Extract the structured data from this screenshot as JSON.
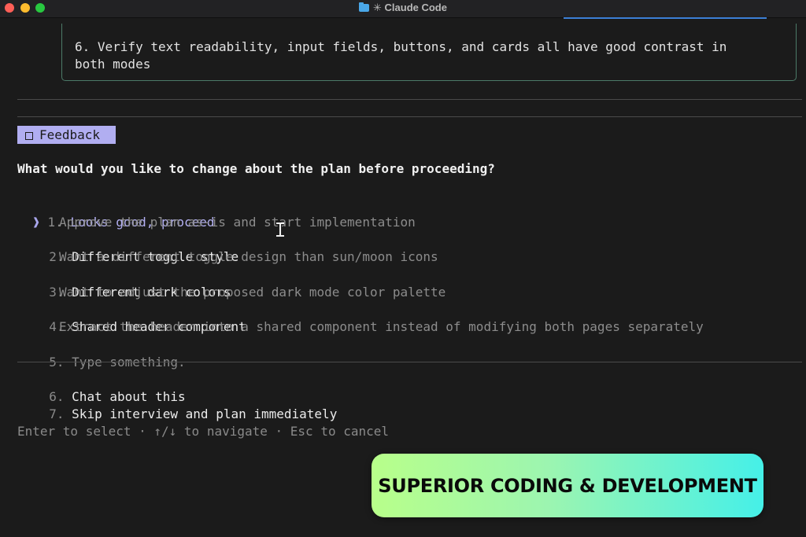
{
  "window": {
    "title": "✳ Claude Code",
    "accent_color": "#3b7fd6"
  },
  "plan_box": {
    "text": "6. Verify text readability, input fields, buttons, and cards all have good contrast in\nboth modes"
  },
  "feedback": {
    "tag_label": "Feedback",
    "tag_color": "#b1aef1",
    "question": "What would you like to change about the plan before proceeding?"
  },
  "options": [
    {
      "number": "1.",
      "label": "Looks good, proceed",
      "description": "Approve the plan as-is and start implementation",
      "selected": true
    },
    {
      "number": "2.",
      "label": "Different toggle style",
      "description": "Want a different toggle design than sun/moon icons"
    },
    {
      "number": "3.",
      "label": "Different dark colors",
      "description": "Want to adjust the proposed dark mode color palette"
    },
    {
      "number": "4.",
      "label": "Shared header component",
      "description": "Extract the header into a shared component instead of modifying both pages separately"
    },
    {
      "number": "5.",
      "label": "Type something.",
      "placeholder": true
    }
  ],
  "extra_options": [
    {
      "number": "6.",
      "label": "Chat about this"
    },
    {
      "number": "7.",
      "label": "Skip interview and plan immediately"
    }
  ],
  "pointer_glyph": "❱",
  "help_text": "Enter to select · ↑/↓ to navigate · Esc to cancel",
  "promo_banner": {
    "text": "SUPERIOR CODING & DEVELOPMENT"
  }
}
